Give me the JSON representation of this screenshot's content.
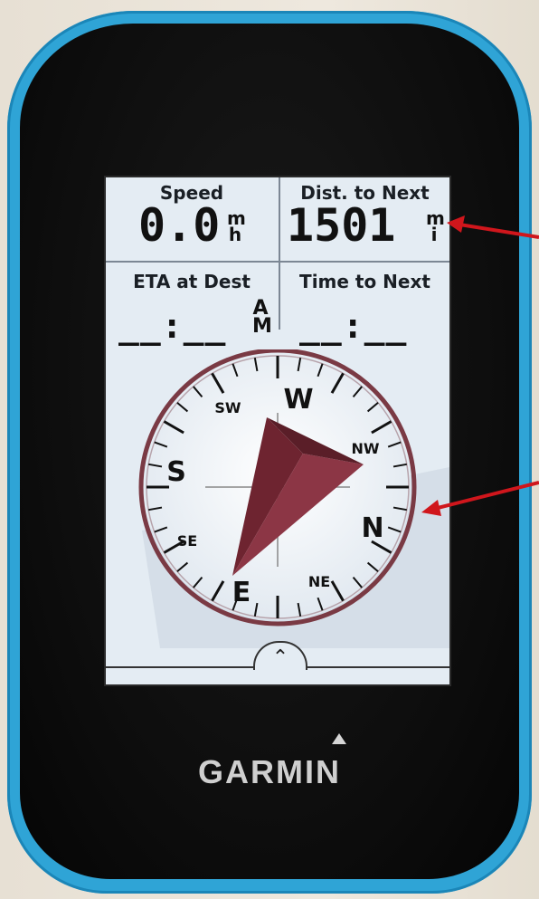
{
  "device": {
    "brand": "GARMIN"
  },
  "data_fields": {
    "speed": {
      "label": "Speed",
      "value": "0.0",
      "unit_top": "m",
      "unit_bottom": "h"
    },
    "dist_to_next": {
      "label": "Dist. to Next",
      "value": "1501",
      "unit_top": "m",
      "unit_bottom": "i"
    },
    "eta_at_dest": {
      "label": "ETA at Dest",
      "value": "__:__",
      "ampm_top": "A",
      "ampm_bottom": "M"
    },
    "time_to_next": {
      "label": "Time to Next",
      "value": "__:__"
    }
  },
  "compass": {
    "cardinals": {
      "w": "W",
      "n": "N",
      "e": "E",
      "s": "S"
    },
    "intercardinals": {
      "sw": "SW",
      "nw": "NW",
      "se": "SE",
      "ne": "NE"
    },
    "heading_direction": "W",
    "bearing_pointer_color": "#7a2a34",
    "ring_color": "#7a3a44"
  },
  "annotations": {
    "arrow_color": "#d0161c"
  }
}
